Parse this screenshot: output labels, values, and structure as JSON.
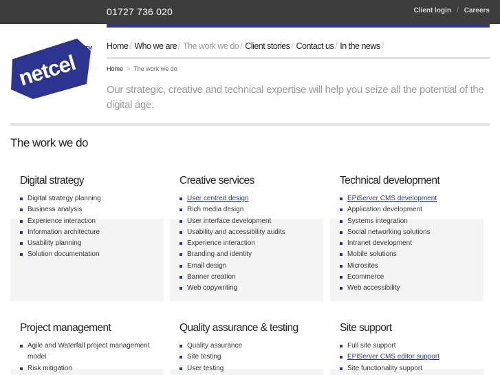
{
  "topbar": {
    "phone": "01727 736 020",
    "client_login": "Client login",
    "separator": "/",
    "careers": "Careers"
  },
  "logo": {
    "text": "netcel",
    "tm": "TM",
    "color": "#2b3590"
  },
  "nav": {
    "items": [
      "Home",
      "Who we are",
      "The work we do",
      "Client stories",
      "Contact us",
      "In the news"
    ],
    "separator": "/",
    "active_index": 2
  },
  "breadcrumb": {
    "home": "Home",
    "separator": ">",
    "current": "The work we do"
  },
  "intro": "Our strategic, creative and technical expertise will help you seize all the potential of the digital age.",
  "page_title": "The work we do",
  "sections": [
    {
      "title": "Digital strategy",
      "items": [
        "Digital strategy planning",
        "Business analysis",
        "Experience interaction",
        "Information architecture",
        "Usability planning",
        "Solution documentation"
      ]
    },
    {
      "title": "Creative services",
      "items": [
        "User centred design",
        "Rich media design",
        "User interface development",
        "Usability and accessibility audits",
        "Experience interaction",
        "Branding and identity",
        "Email design",
        "Banner creation",
        "Web copywriting"
      ]
    },
    {
      "title": "Technical development",
      "items": [
        "EPiServer CMS development",
        "Application development",
        "Systems integration",
        "Social networking solutions",
        "Intranet development",
        "Mobile solutions",
        "Microsites",
        "Ecommerce",
        "Web accessibility"
      ]
    },
    {
      "title": "Project management",
      "items": [
        "Agile and Waterfall project management model",
        "Risk mitigation"
      ]
    },
    {
      "title": "Quality assurance & testing",
      "items": [
        "Quality assurance",
        "Site testing",
        "User testing"
      ]
    },
    {
      "title": "Site support",
      "items": [
        "Full site support",
        "EPiServer CMS editor support",
        "Site functionality support"
      ]
    }
  ],
  "colors": {
    "accent": "#2b3590",
    "topbar": "#3d3d3d",
    "panel": "#f4f4f4"
  }
}
